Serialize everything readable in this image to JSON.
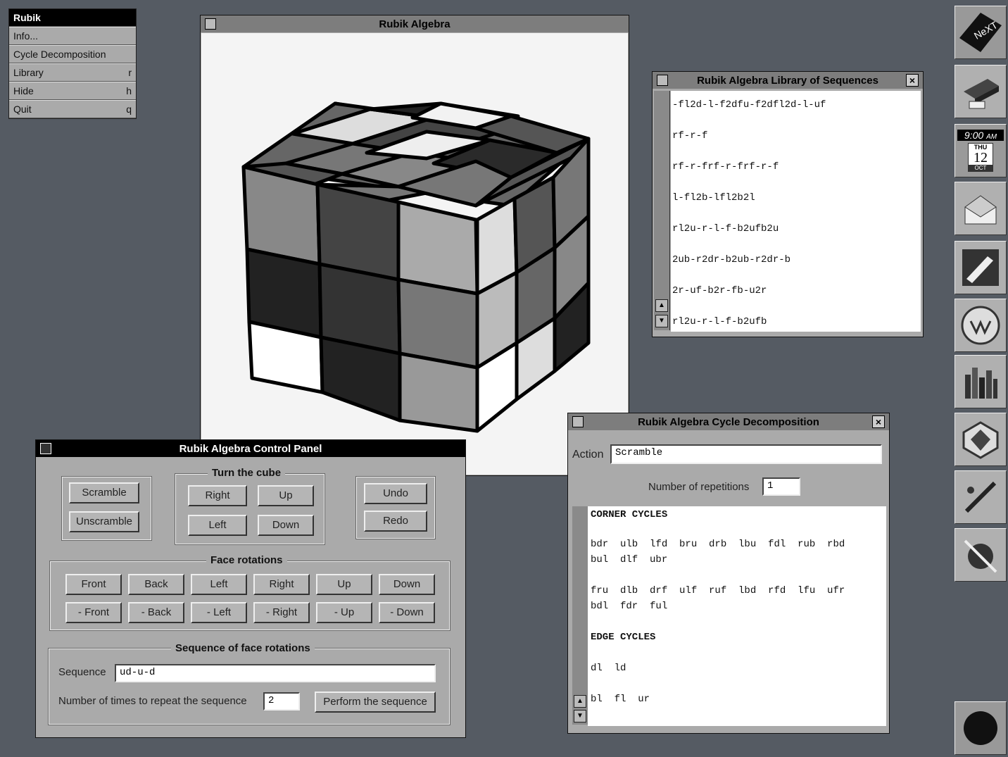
{
  "menu": {
    "title": "Rubik",
    "items": [
      {
        "label": "Info...",
        "key": ""
      },
      {
        "label": "Cycle Decomposition",
        "key": ""
      },
      {
        "label": "Library",
        "key": "r"
      },
      {
        "label": "Hide",
        "key": "h"
      },
      {
        "label": "Quit",
        "key": "q"
      }
    ]
  },
  "main_window": {
    "title": "Rubik Algebra"
  },
  "library": {
    "title": "Rubik Algebra Library of Sequences",
    "items": [
      "-fl2d-l-f2dfu-f2dfl2d-l-uf",
      "rf-r-f",
      "rf-r-frf-r-frf-r-f",
      "l-fl2b-lfl2b2l",
      "rl2u-r-l-f-b2ufb2u",
      "2ub-r2dr-b2ub-r2dr-b",
      "2r-uf-b2r-fb-u2r",
      "rl2u-r-l-f-b2ufb"
    ]
  },
  "control_panel": {
    "title": "Rubik Algebra Control Panel",
    "scramble": "Scramble",
    "unscramble": "Unscramble",
    "turn_label": "Turn the cube",
    "turn": {
      "right": "Right",
      "up": "Up",
      "left": "Left",
      "down": "Down"
    },
    "undo": "Undo",
    "redo": "Redo",
    "face_label": "Face rotations",
    "face_top": [
      "Front",
      "Back",
      "Left",
      "Right",
      "Up",
      "Down"
    ],
    "face_bottom": [
      "- Front",
      "- Back",
      "- Left",
      "- Right",
      "- Up",
      "- Down"
    ],
    "seq_label": "Sequence of face rotations",
    "seq_field_label": "Sequence",
    "seq_value": "ud-u-d",
    "repeat_label": "Number of times to repeat the sequence",
    "repeat_value": "2",
    "perform": "Perform the sequence"
  },
  "cycle": {
    "title": "Rubik Algebra Cycle Decomposition",
    "action_label": "Action",
    "action_value": "Scramble",
    "reps_label": "Number of repetitions",
    "reps_value": "1",
    "corner_heading": "CORNER CYCLES",
    "corner_line1": "bdr  ulb  lfd  bru  drb  lbu  fdl  rub  rbd",
    "corner_line2": "bul  dlf  ubr",
    "corner_line3": "fru  dlb  drf  ulf  ruf  lbd  rfd  lfu  ufr",
    "corner_line4": "bdl  fdr  ful",
    "edge_heading": "EDGE CYCLES",
    "edge_line1": "dl  ld",
    "edge_line2": "bl  fl  ur"
  },
  "dock": {
    "logo": "NeXT",
    "clock_time": "9:00",
    "clock_ampm": "AM",
    "clock_day": "THU",
    "clock_date": "12",
    "clock_month": "OCT"
  },
  "colors": {
    "desktop": "#555b63",
    "window": "#aaaaaa",
    "titlebar_active": "#000000"
  }
}
